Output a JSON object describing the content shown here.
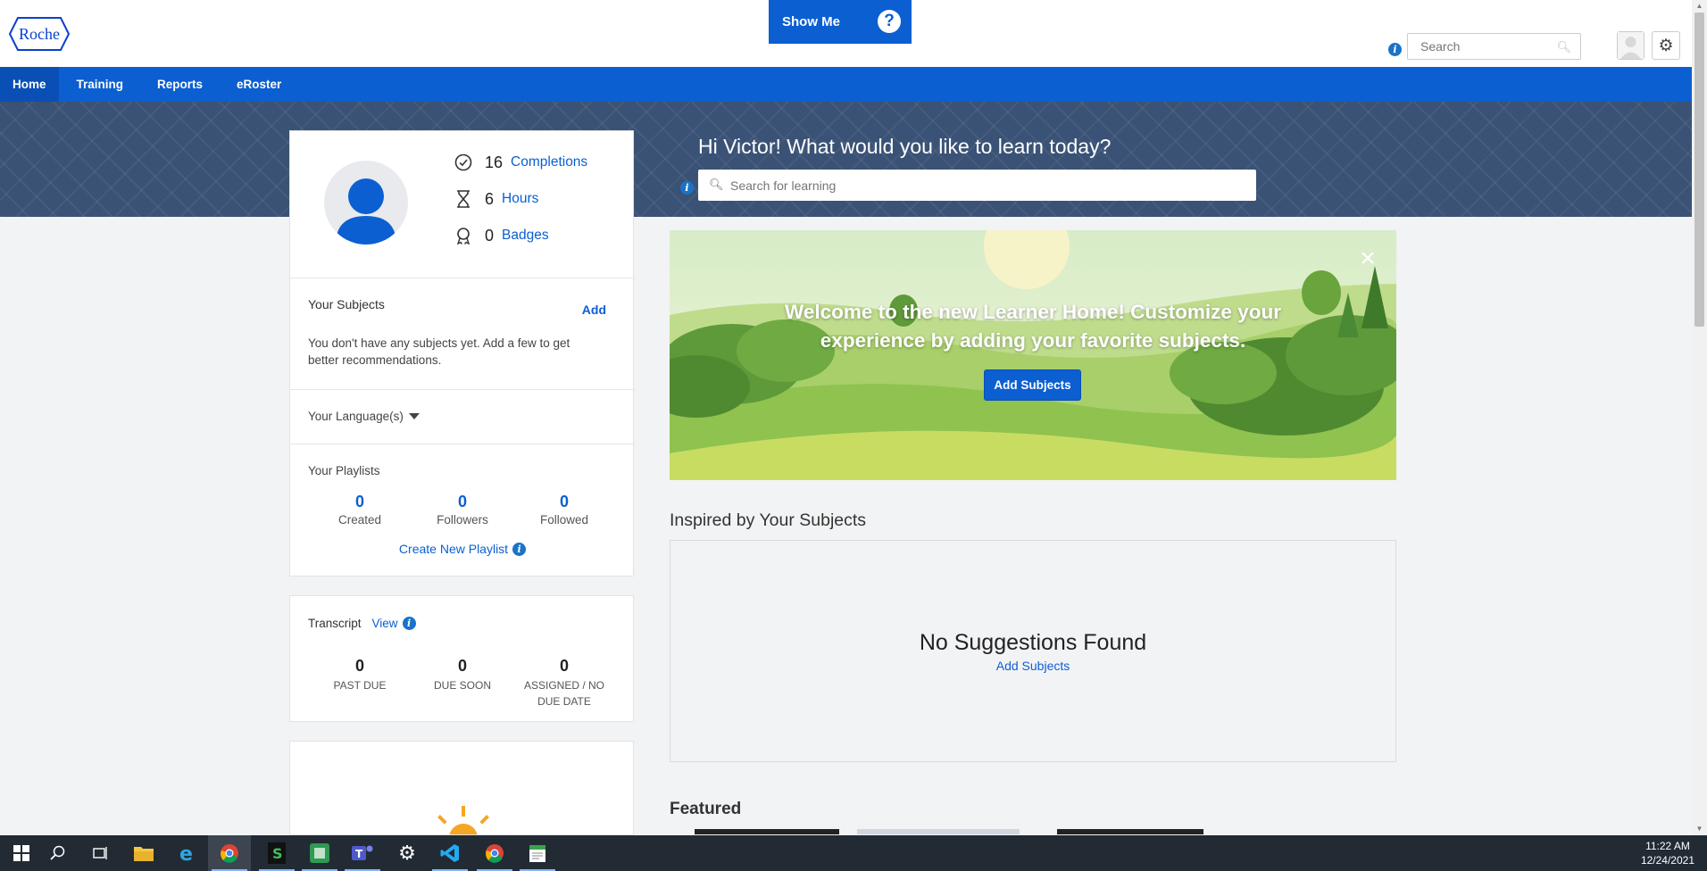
{
  "header": {
    "logo_text": "Roche",
    "show_me_label": "Show Me",
    "show_me_icon": "?",
    "search_placeholder": "Search",
    "info_glyph": "i",
    "brand_color": "#0b5fd1"
  },
  "nav": {
    "items": [
      {
        "label": "Home",
        "active": true
      },
      {
        "label": "Training"
      },
      {
        "label": "Reports"
      },
      {
        "label": "eRoster"
      }
    ]
  },
  "hero": {
    "greeting": "Hi Victor! What would you like to learn today?",
    "search_placeholder": "Search for learning"
  },
  "profile": {
    "stats": [
      {
        "icon": "check-circle-icon",
        "value": "16",
        "label": "Completions"
      },
      {
        "icon": "hourglass-icon",
        "value": "6",
        "label": "Hours"
      },
      {
        "icon": "badge-icon",
        "value": "0",
        "label": "Badges"
      }
    ],
    "subjects": {
      "title": "Your Subjects",
      "add_label": "Add",
      "empty_text": "You don't have any subjects yet. Add a few to get better recommendations."
    },
    "language": {
      "title": "Your Language(s)"
    },
    "playlists": {
      "title": "Your Playlists",
      "counts": [
        {
          "value": "0",
          "label": "Created"
        },
        {
          "value": "0",
          "label": "Followers"
        },
        {
          "value": "0",
          "label": "Followed"
        }
      ],
      "create_label": "Create New Playlist"
    }
  },
  "transcript": {
    "title": "Transcript",
    "view_label": "View",
    "counts": [
      {
        "value": "0",
        "label": "PAST DUE"
      },
      {
        "value": "0",
        "label": "DUE SOON"
      },
      {
        "value": "0",
        "label": "ASSIGNED / NO DUE DATE"
      }
    ]
  },
  "banner": {
    "text": "Welcome to the new Learner Home! Customize your experience by adding your favorite subjects.",
    "button_label": "Add Subjects",
    "close_glyph": "×"
  },
  "inspired": {
    "title": "Inspired by Your Subjects",
    "empty_title": "No Suggestions Found",
    "add_label": "Add Subjects"
  },
  "featured": {
    "title": "Featured"
  },
  "taskbar": {
    "time": "11:22 AM",
    "date": "12/24/2021"
  }
}
